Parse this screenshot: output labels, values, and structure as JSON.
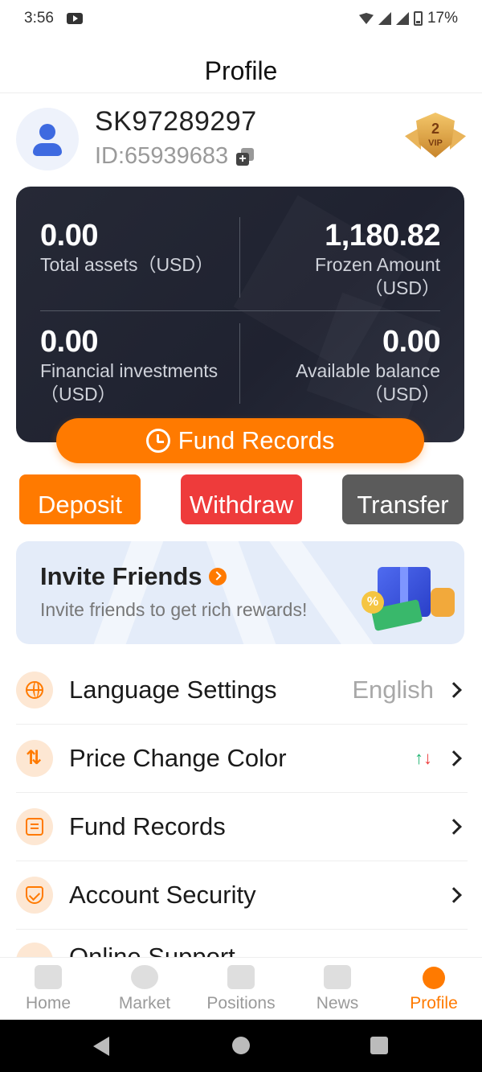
{
  "status_bar": {
    "time": "3:56",
    "battery": "17%"
  },
  "header": {
    "title": "Profile"
  },
  "user": {
    "username": "SK97289297",
    "id_text": "ID:65939683",
    "vip_level": "2",
    "vip_label": "VIP"
  },
  "assets": {
    "total": {
      "value": "0.00",
      "label": "Total assets（USD）"
    },
    "frozen": {
      "value": "1,180.82",
      "label": "Frozen Amount\n（USD）"
    },
    "financial": {
      "value": "0.00",
      "label": "Financial investments\n（USD）"
    },
    "available": {
      "value": "0.00",
      "label": "Available balance\n（USD）"
    }
  },
  "fund_records_button": "Fund Records",
  "actions": {
    "deposit": "Deposit",
    "withdraw": "Withdraw",
    "transfer": "Transfer"
  },
  "invite": {
    "title": "Invite Friends",
    "subtitle": "Invite friends to get rich rewards!",
    "pct": "%"
  },
  "menu": [
    {
      "label": "Language Settings",
      "value": "English"
    },
    {
      "label": "Price Change Color"
    },
    {
      "label": "Fund Records"
    },
    {
      "label": "Account Security"
    },
    {
      "label": "Online Support"
    }
  ],
  "tabs": [
    "Home",
    "Market",
    "Positions",
    "News",
    "Profile"
  ],
  "colors": {
    "accent": "#ff7a00",
    "withdraw": "#ee3b3b",
    "transfer": "#5b5b5b",
    "card": "#232634"
  }
}
